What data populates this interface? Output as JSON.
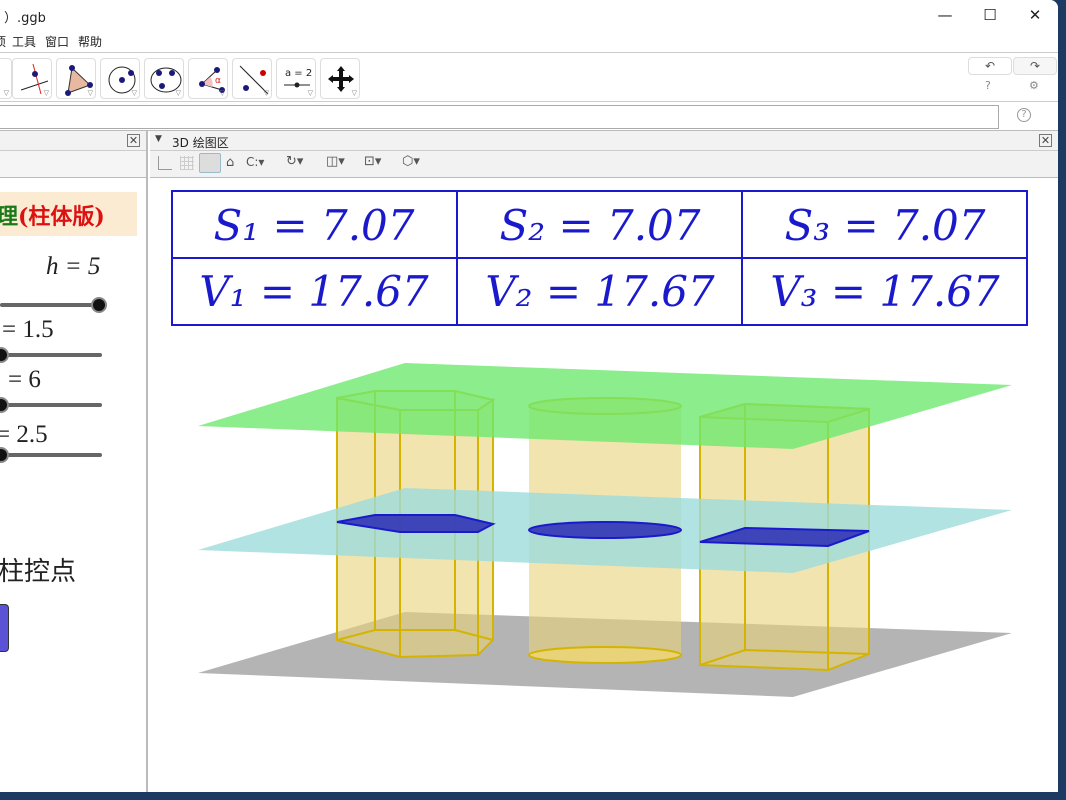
{
  "window": {
    "title": "）.ggb",
    "min": "—",
    "max": "☐",
    "close": "✕"
  },
  "menu": [
    "项",
    "工具",
    "窗口",
    "帮助"
  ],
  "toolbar": {
    "tools": [
      "line-tool",
      "perpendicular-line-tool",
      "polygon-tool",
      "circle-tool",
      "conic-tool",
      "angle-tool",
      "reflect-tool",
      "slider-tool",
      "move-graphics-tool"
    ],
    "slider_label": "a = 2",
    "undo": "↶",
    "redo": "↷",
    "help": "?",
    "settings": "⚙"
  },
  "input": {
    "value": "",
    "help": "?"
  },
  "left_panel": {
    "title": "理(柱体版)",
    "title_prefix": "理",
    "title_main": "(柱体版)",
    "sliders": [
      {
        "label": "h = 5",
        "fraction": 1.0
      },
      {
        "label": "= 1.5",
        "fraction": 0.0
      },
      {
        "label": "= 6",
        "fraction": 0.0
      },
      {
        "label": "= 2.5",
        "fraction": 0.0
      }
    ],
    "text": "柱控点"
  },
  "view3d": {
    "title": "3D 绘图区",
    "table": [
      [
        "S₁ = 7.07",
        "S₂ = 7.07",
        "S₃ = 7.07"
      ],
      [
        "V₁ = 17.67",
        "V₂ = 17.67",
        "V₃ = 17.67"
      ]
    ],
    "colors": {
      "table": "#1a1acc",
      "top_plane": "#6ee86e",
      "mid_plane": "#9edcdc",
      "base_plane": "#b0b0b0",
      "solid": "#e8d27a",
      "section": "#2a2ab4"
    }
  }
}
